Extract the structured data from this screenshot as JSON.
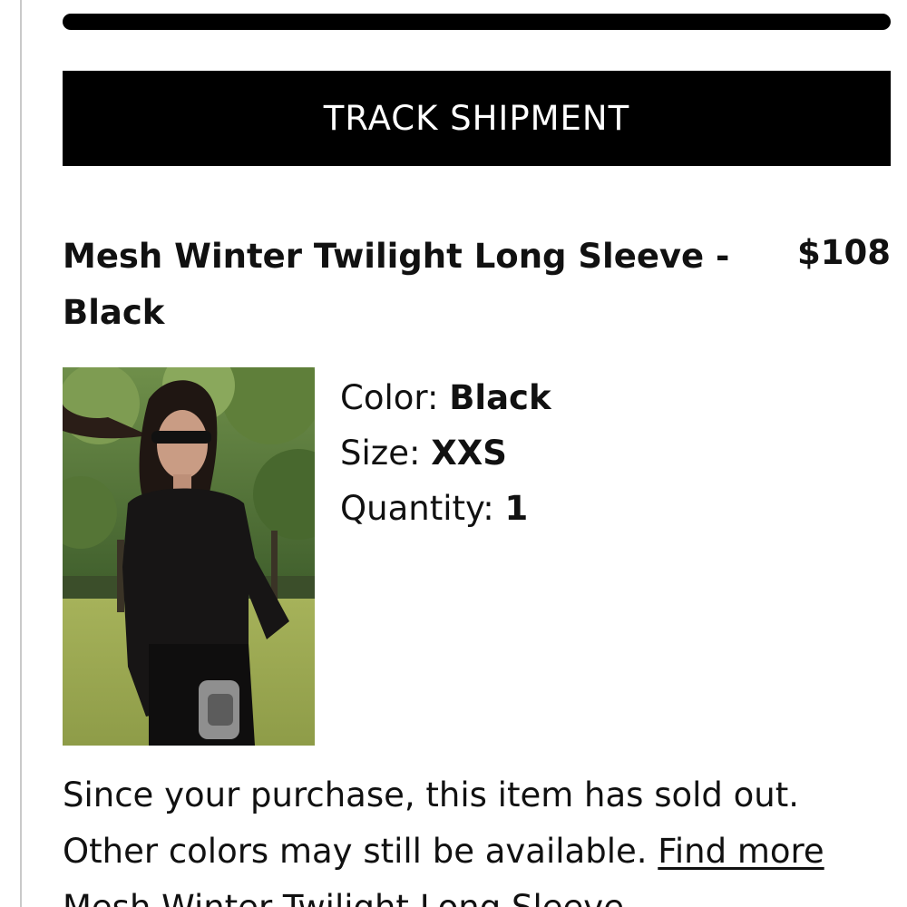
{
  "order": {
    "track_button_label": "TRACK SHIPMENT"
  },
  "product": {
    "title": "Mesh Winter Twilight Long Sleeve - Black",
    "price": "$108",
    "color_label": "Color:",
    "color_value": "Black",
    "size_label": "Size:",
    "size_value": "XXS",
    "quantity_label": "Quantity:",
    "quantity_value": "1"
  },
  "notice": {
    "text": "Since your purchase, this item has sold out. Other colors may still be available.",
    "link_text": "Find more Mesh Winter Twilight Long Sleeve"
  },
  "colors": {
    "primary": "#000000",
    "text": "#111111",
    "background": "#ffffff"
  }
}
